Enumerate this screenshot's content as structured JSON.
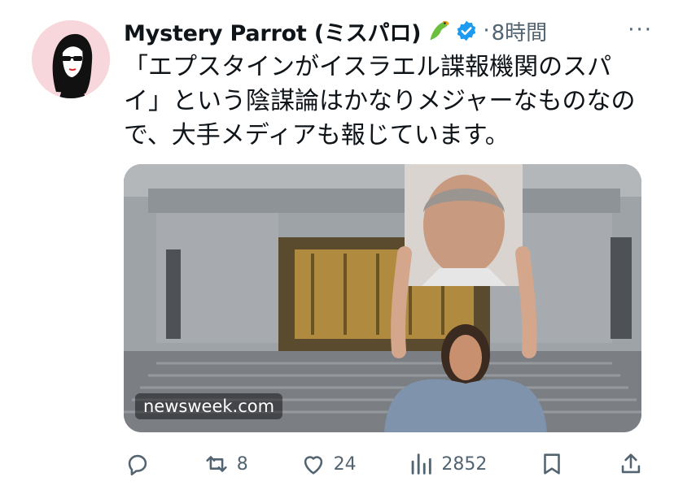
{
  "post": {
    "author_name": "Mystery Parrot (ミスパロ)",
    "separator": "·",
    "time": "8時間",
    "more_icon": "more-horizontal-icon",
    "text": "「エプスタインがイスラエル諜報機関のスパ\nイ」という陰謀論はかなりメジャーなものなの\nで、大手メディアも報じています。",
    "media": {
      "source_label": "newsweek.com"
    }
  },
  "actions": {
    "reply": {
      "icon": "reply-icon",
      "count": ""
    },
    "repost": {
      "icon": "repost-icon",
      "count": "8"
    },
    "like": {
      "icon": "heart-icon",
      "count": "24"
    },
    "views": {
      "icon": "views-icon",
      "count": "2852"
    },
    "bookmark": {
      "icon": "bookmark-icon"
    },
    "share": {
      "icon": "share-icon"
    }
  },
  "colors": {
    "text": "#0f1419",
    "muted": "#536471",
    "verified": "#1d9bf0",
    "avatar_bg": "#f7d7dc"
  }
}
